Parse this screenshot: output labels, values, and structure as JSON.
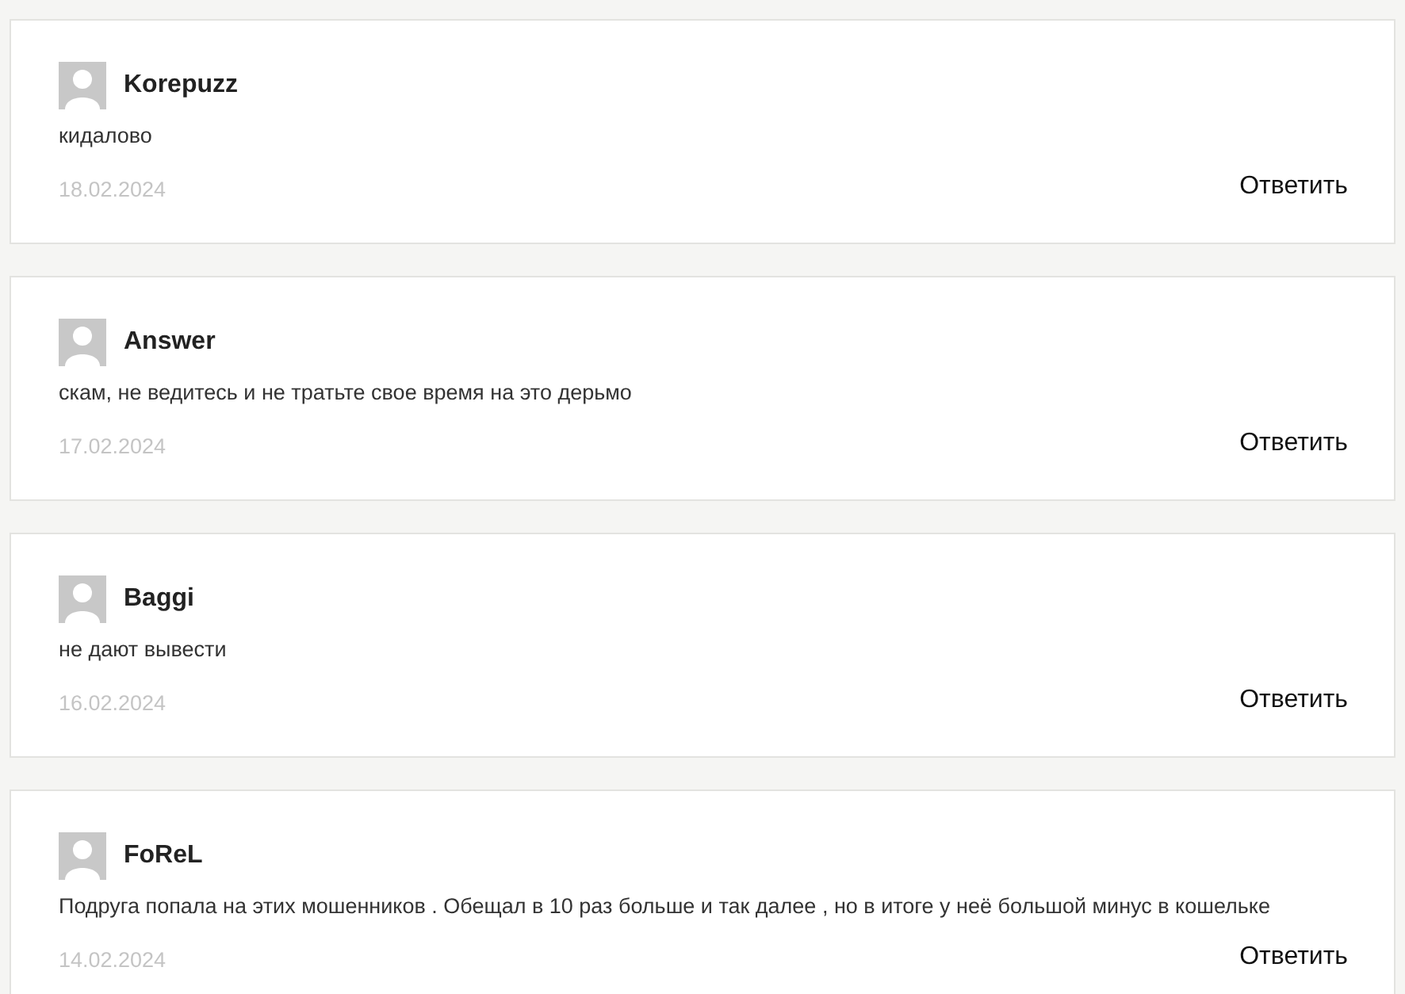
{
  "comments": [
    {
      "author": "Korepuzz",
      "text": "кидалово",
      "date": "18.02.2024",
      "reply": "Ответить"
    },
    {
      "author": "Answer",
      "text": "скам, не ведитесь и не тратьте свое время на это дерьмо",
      "date": "17.02.2024",
      "reply": "Ответить"
    },
    {
      "author": "Baggi",
      "text": "не дают вывести",
      "date": "16.02.2024",
      "reply": "Ответить"
    },
    {
      "author": "FoReL",
      "text": "Подруга попала на этих мошенников . Обещал в 10 раз больше и так далее , но в итоге у неё большой минус в кошельке",
      "date": "14.02.2024",
      "reply": "Ответить"
    }
  ]
}
